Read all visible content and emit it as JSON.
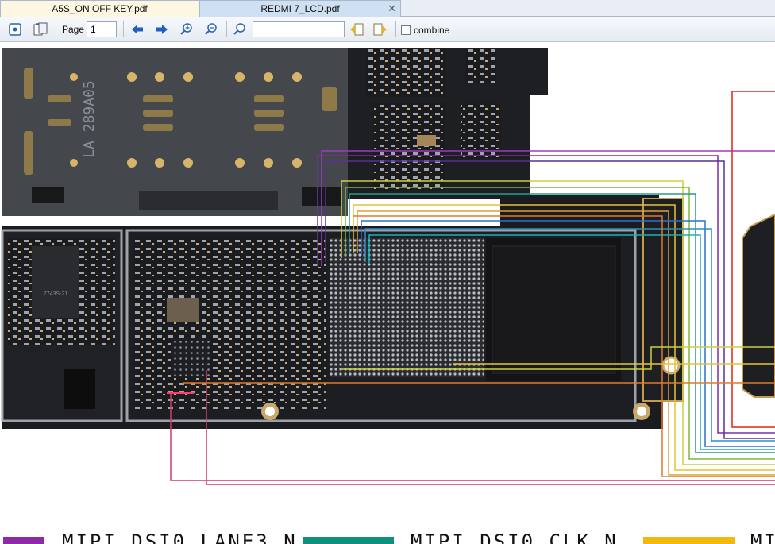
{
  "tabs": [
    {
      "label": "A5S_ON OFF KEY.pdf",
      "active": false
    },
    {
      "label": "REDMI 7_LCD.pdf",
      "active": true
    }
  ],
  "toolbar": {
    "page_label": "Page",
    "page_value": "1",
    "search_value": "",
    "combine_label": "combine",
    "combine_checked": false
  },
  "icons": {
    "fit": "fit-page-icon",
    "rotate": "rotate-page-icon",
    "prev": "arrow-left-icon",
    "next": "arrow-right-icon",
    "zoom_in": "zoom-in-icon",
    "zoom_out": "zoom-out-icon",
    "search": "search-icon",
    "find_prev": "find-previous-icon",
    "find_next": "find-next-icon",
    "close_tab": "close-icon"
  },
  "colors": {
    "accent_blue": "#1f5fbf",
    "board": "#1c1d20",
    "legend_purple": "#8e2aa8",
    "legend_teal": "#0f8f7c",
    "legend_yellow": "#f2b80f"
  },
  "document": {
    "board_label_line1": "LA 289A05",
    "chip_label": "7743S-21",
    "legend": [
      {
        "label": "MIPI_DSI0_LANE3_N",
        "color": "#8e2aa8"
      },
      {
        "label": "MIPI_DSI0_CLK_N",
        "color": "#0f8f7c"
      },
      {
        "label": "MI",
        "color": "#f2b80f"
      }
    ]
  }
}
